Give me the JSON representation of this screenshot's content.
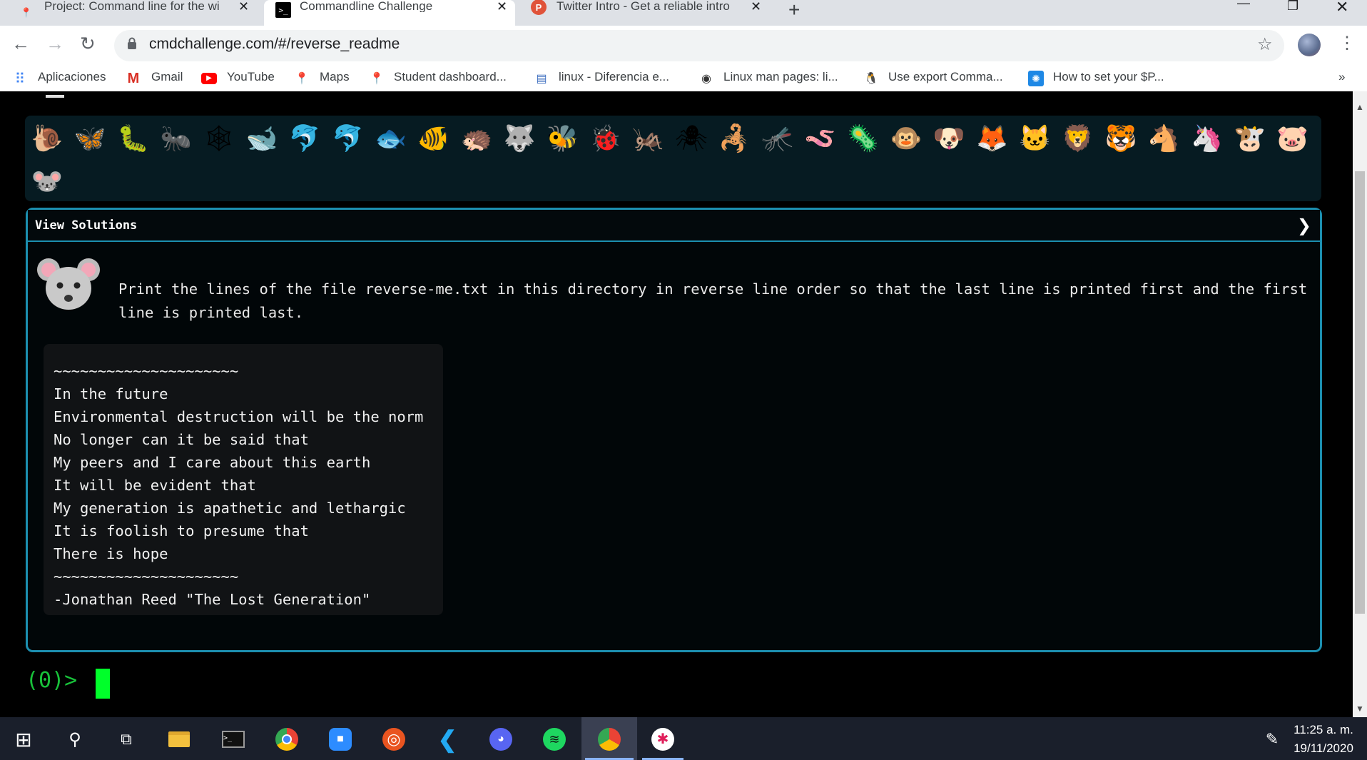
{
  "tabs": [
    {
      "label": "Project: Command line for the wi",
      "icon": "red-pin-icon"
    },
    {
      "label": "Commandline Challenge",
      "icon": "terminal-icon"
    },
    {
      "label": "Twitter Intro - Get a reliable intro",
      "icon": "p-badge-icon"
    }
  ],
  "url": "cmdchallenge.com/#/reverse_readme",
  "bookmarks": [
    {
      "label": "Aplicaciones",
      "icon": "apps-grid-icon"
    },
    {
      "label": "Gmail",
      "icon": "gmail-icon"
    },
    {
      "label": "YouTube",
      "icon": "youtube-icon"
    },
    {
      "label": "Maps",
      "icon": "maps-pin-icon"
    },
    {
      "label": "Student dashboard...",
      "icon": "red-pin-icon"
    },
    {
      "label": "linux - Diferencia e...",
      "icon": "stack-icon"
    },
    {
      "label": "Linux man pages: li...",
      "icon": "globe-icon"
    },
    {
      "label": "Use export Comma...",
      "icon": "penguin-icon"
    },
    {
      "label": "How to set your $P...",
      "icon": "gear-blue-icon"
    }
  ],
  "bookmarks_overflow": "»",
  "animals": [
    "🐌",
    "🦋",
    "🐛",
    "🐜",
    "🕸",
    "🐋",
    "🐬",
    "🐬",
    "🐟",
    "🐠",
    "🦔",
    "🐺",
    "🐝",
    "🐞",
    "🦗",
    "🕷",
    "🦂",
    "🦟",
    "🪱",
    "🦠",
    "🐵",
    "🐶",
    "🦊",
    "🐱",
    "🦁",
    "🐯",
    "🐴",
    "🦄",
    "🐮",
    "🐷",
    "🐭"
  ],
  "panel": {
    "title": "View Solutions",
    "chevron": "❯",
    "prompt": "Print the lines of the file reverse-me.txt in this directory in reverse line order so that the last line is printed first and the first line is printed last.",
    "poem": [
      "~~~~~~~~~~~~~~~~~~~~~",
      "In the future",
      "Environmental destruction will be the norm",
      "No longer can it be said that",
      "My peers and I care about this earth",
      "It will be evident that",
      "My generation is apathetic and lethargic",
      "It is foolish to presume that",
      "There is hope",
      "~~~~~~~~~~~~~~~~~~~~~",
      "-Jonathan Reed \"The Lost Generation\""
    ]
  },
  "terminal": {
    "prompt": "(0)>"
  },
  "clock": {
    "time": "11:25 a. m.",
    "date": "19/11/2020"
  }
}
